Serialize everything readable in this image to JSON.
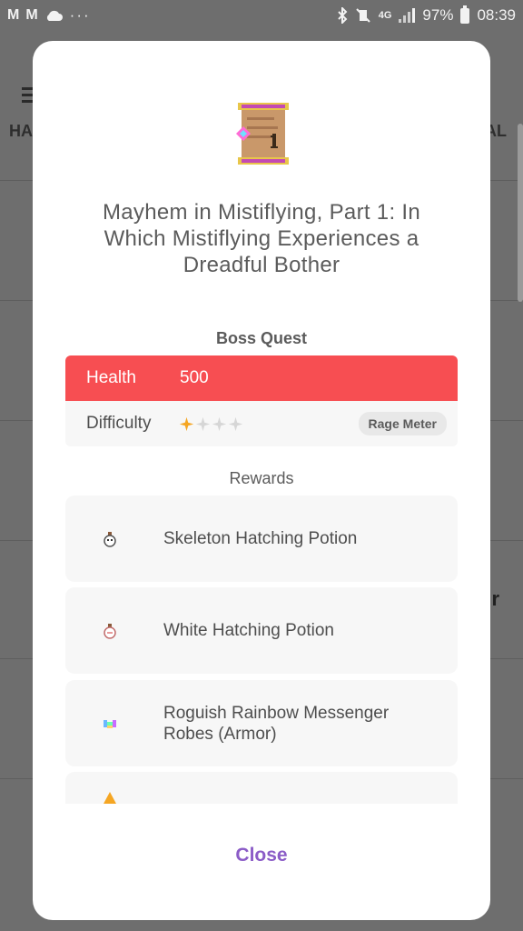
{
  "status_bar": {
    "left_icons": [
      "gmail-icon",
      "gmail-icon",
      "cloud-icon",
      "more-icon"
    ],
    "right_icons": [
      "bluetooth-icon",
      "vibrate-icon",
      "lte-icon",
      "signal-icon",
      "battery-icon"
    ],
    "network": "4G",
    "battery": "97%",
    "time": "08:39"
  },
  "background": {
    "tab_left": "HA",
    "tab_right": "AL",
    "side_char": "r"
  },
  "quest": {
    "icon": "quest-scroll-icon",
    "title": "Mayhem in Mistiflying, Part 1: In Which Mistiflying Experiences a Dreadful Bother",
    "type_label": "Boss Quest",
    "health_label": "Health",
    "health_value": "500",
    "difficulty_label": "Difficulty",
    "difficulty_stars": 1,
    "difficulty_max_stars": 4,
    "rage_label": "Rage Meter"
  },
  "rewards": {
    "label": "Rewards",
    "items": [
      {
        "name": "Skeleton Hatching Potion",
        "icon": "skeleton-potion-icon"
      },
      {
        "name": "White Hatching Potion",
        "icon": "white-potion-icon"
      },
      {
        "name": "Roguish Rainbow Messenger Robes (Armor)",
        "icon": "armor-robe-icon"
      },
      {
        "name": "",
        "icon": "gold-triangle-icon"
      }
    ]
  },
  "colors": {
    "health_red": "#f74e52",
    "star_gold": "#f5a623",
    "star_empty": "#d6d6d6",
    "close_purple": "#8b5cc7"
  },
  "close_label": "Close"
}
